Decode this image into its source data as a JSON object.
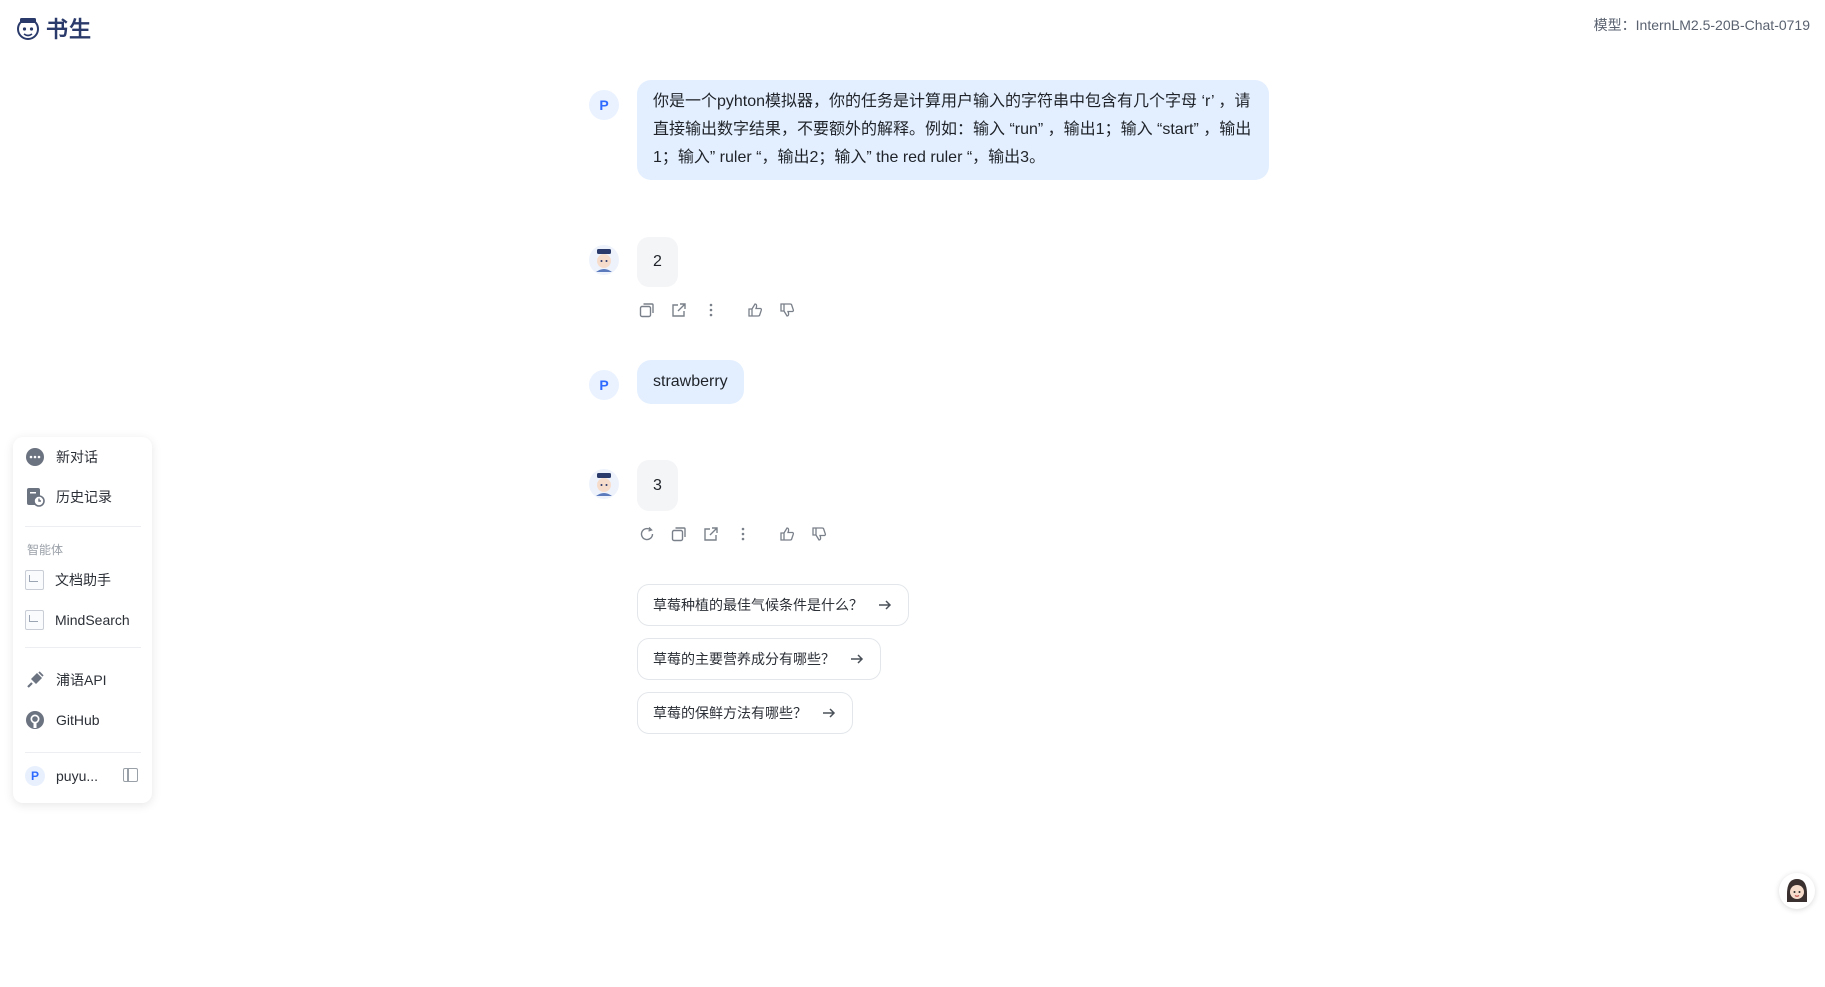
{
  "header": {
    "logo_text": "书生",
    "model_label": "模型：InternLM2.5-20B-Chat-0719"
  },
  "sidebar": {
    "new_chat": "新对话",
    "history": "历史记录",
    "agents_section": "智能体",
    "agents": [
      {
        "label": "文档助手"
      },
      {
        "label": "MindSearch"
      }
    ],
    "api": "浦语API",
    "github": "GitHub",
    "user_initial": "P",
    "user_name": "puyu..."
  },
  "chat": {
    "user_initial": "P",
    "messages": [
      {
        "role": "user",
        "text": "你是一个pyhton模拟器，你的任务是计算用户输入的字符串中包含有几个字母 ‘r’ ，请直接输出数字结果，不要额外的解释。例如：输入 “run” ，输出1；输入 “start” ，输出1；输入” ruler “，输出2；输入” the red ruler “，输出3。"
      },
      {
        "role": "assistant",
        "text": "2"
      },
      {
        "role": "user",
        "text": "strawberry"
      },
      {
        "role": "assistant",
        "text": "3"
      }
    ],
    "suggestions": [
      "草莓种植的最佳气候条件是什么？",
      "草莓的主要营养成分有哪些？",
      "草莓的保鲜方法有哪些？"
    ]
  },
  "icons": {
    "copy": "copy-icon",
    "share": "share-icon",
    "more": "more-icon",
    "like": "thumbs-up-icon",
    "dislike": "thumbs-down-icon",
    "regenerate": "regenerate-icon",
    "arrow": "arrow-right-icon"
  },
  "colors": {
    "accent": "#2f6bff",
    "user_bubble": "#e3efff",
    "bot_bubble": "#f4f5f7"
  }
}
